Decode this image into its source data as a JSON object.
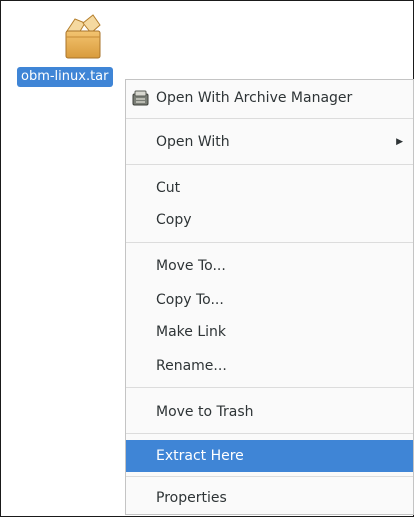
{
  "desktop": {
    "file": {
      "icon": "package-icon",
      "name": "obm-linux.tar"
    }
  },
  "context_menu": {
    "items": [
      {
        "label": "Open With Archive Manager",
        "icon": "archive-manager-icon"
      },
      {
        "label": "Open With",
        "submenu": true
      },
      {
        "label": "Cut"
      },
      {
        "label": "Copy"
      },
      {
        "label": "Move To..."
      },
      {
        "label": "Copy To..."
      },
      {
        "label": "Make Link"
      },
      {
        "label": "Rename..."
      },
      {
        "label": "Move to Trash"
      },
      {
        "label": "Extract Here",
        "selected": true
      },
      {
        "label": "Properties"
      }
    ],
    "highlight_color": "#3f85d6"
  }
}
